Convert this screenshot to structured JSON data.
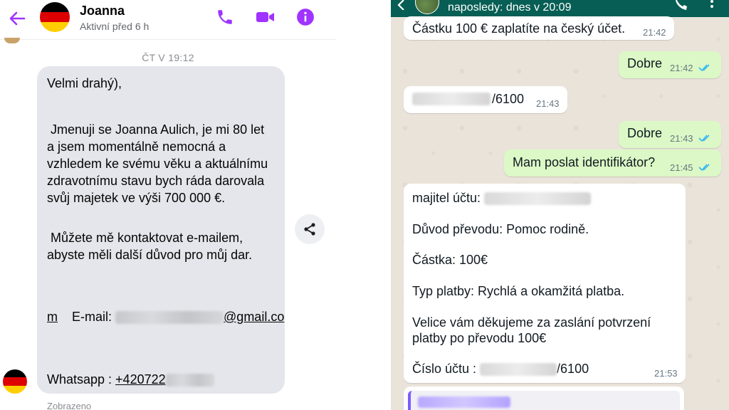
{
  "messenger": {
    "contact_name": "Joanna",
    "status": "Aktivní před 6 h",
    "timestamp": "ČT V 19:12",
    "message": {
      "greeting": "Velmi drahý),",
      "intro_lines": [
        " Jmenuji se Joanna Aulich, je mi 80 let",
        "a jsem momentálně nemocná a",
        "vzhledem ke svému věku a aktuálnímu",
        "zdravotnímu stavu bych ráda darovala",
        "svůj majetek ve výši 700 000 €."
      ],
      "contact_lines": [
        " Můžete mě kontaktovat e-mailem,",
        "abyste měli další důvod pro můj dar."
      ],
      "email_label": " E-mail: ",
      "email_domain_1": "@gmail.co",
      "email_domain_2": "m",
      "whatsapp_label": "Whatsapp : ",
      "whatsapp_prefix": "+420722"
    },
    "seen_label": "Zobrazeno",
    "colors": {
      "accent": "#a033ff",
      "bubble": "#e4e6eb"
    },
    "icons": [
      "back-arrow-icon",
      "phone-icon",
      "video-icon",
      "info-icon",
      "share-icon"
    ]
  },
  "whatsapp": {
    "header_status": "naposledy: dnes v 20:09",
    "messages": [
      {
        "dir": "in",
        "text": "Částku 100 € zaplatíte na český účet.",
        "time": "21:42"
      },
      {
        "dir": "out",
        "text": "Dobre",
        "time": "21:42"
      },
      {
        "dir": "in",
        "text": "/6100",
        "time": "21:43"
      },
      {
        "dir": "out",
        "text": "Dobre",
        "time": "21:43"
      },
      {
        "dir": "out",
        "text": "Mam poslat identifikátor?",
        "time": "21:45"
      }
    ],
    "details": {
      "owner_label": "majitel účtu: ",
      "reason": "Důvod převodu: Pomoc rodině.",
      "amount": "Částka: 100€",
      "payment_type": "Typ platby: Rychlá a okamžitá platba.",
      "thanks_1": "Velice vám děkujeme za zaslání potvrzení",
      "thanks_2": "platby po převodu 100€",
      "account_label": "Číslo účtu : ",
      "account_suffix": "/6100",
      "time": "21:53"
    },
    "colors": {
      "header": "#075e54",
      "outgoing": "#dcf8c6",
      "incoming": "#ffffff",
      "ticks": "#34b7f1"
    },
    "icons": [
      "back-arrow-icon",
      "phone-icon",
      "menu-icon",
      "double-check-icon"
    ]
  }
}
